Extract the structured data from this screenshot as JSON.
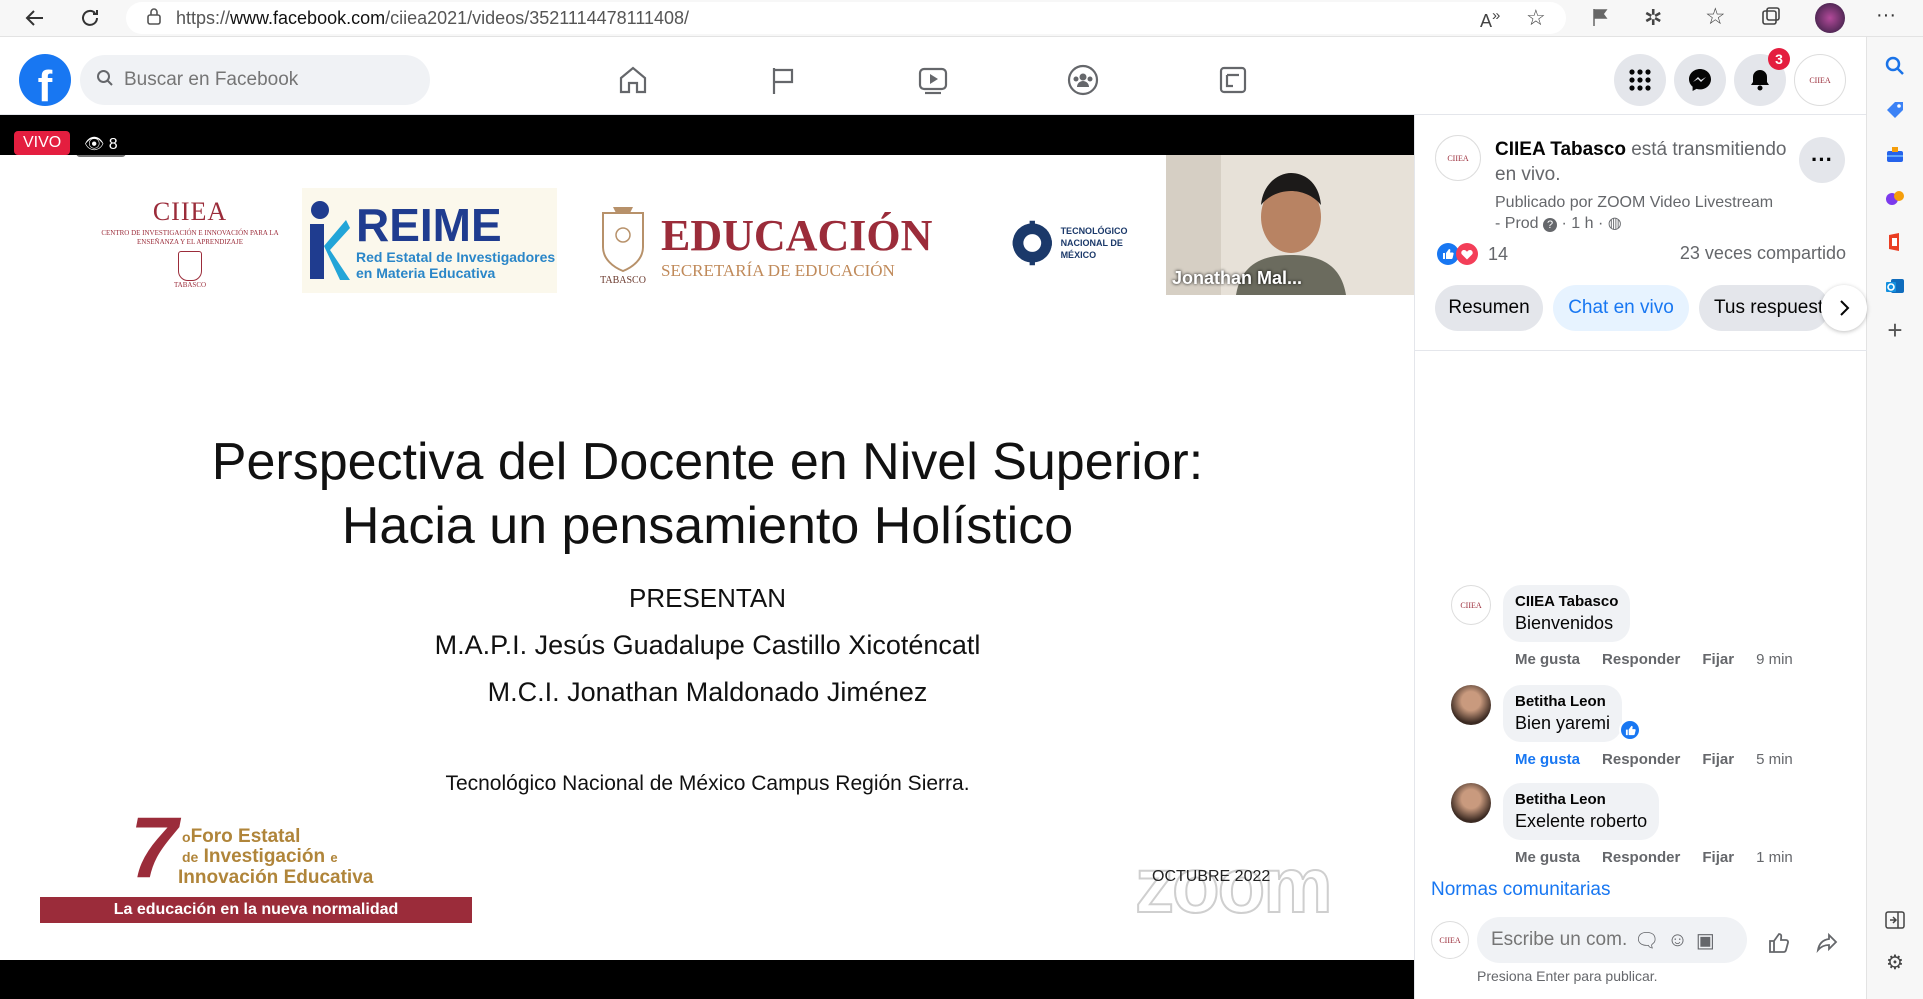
{
  "browser": {
    "url_prefix": "https://",
    "url_host": "www.facebook.com",
    "url_path": "/ciiea2021/videos/3521114478111408/"
  },
  "facebook": {
    "search_placeholder": "Buscar en Facebook",
    "notification_count": "3",
    "avatar_label": "CIIEA"
  },
  "video": {
    "live_label": "VIVO",
    "viewers": "8",
    "slide": {
      "ciiea_logo_title": "CIIEA",
      "ciiea_logo_subtitle": "CENTRO DE INVESTIGACIÓN E INNOVACIÓN PARA LA ENSEÑANZA Y EL APRENDIZAJE",
      "ciiea_logo_place": "TABASCO",
      "reime_title": "REIME",
      "reime_line1": "Red Estatal de Investigadores",
      "reime_line2": "en Materia Educativa",
      "edu_title": "EDUCACIÓN",
      "edu_subtitle": "SECRETARÍA DE EDUCACIÓN",
      "edu_place": "TABASCO",
      "tec_line1": "TECNOLÓGICO",
      "tec_line2": "NACIONAL DE MÉXICO",
      "title_line1": "Perspectiva del Docente en Nivel Superior:",
      "title_line2": "Hacia un pensamiento Holístico",
      "presentan": "PRESENTAN",
      "presenter1": "M.A.P.I. Jesús Guadalupe Castillo Xicoténcatl",
      "presenter2": "M.C.I. Jonathan Maldonado Jiménez",
      "institution": "Tecnológico Nacional de México Campus Región Sierra.",
      "foro_number": "7",
      "foro_sup": "o",
      "foro_line1": "Foro Estatal",
      "foro_line2_prefix": "de",
      "foro_line2": "Investigación",
      "foro_line2_suffix": "e",
      "foro_line3": "Innovación Educativa",
      "foro_banner": "La educación en la nueva normalidad",
      "date": "OCTUBRE 2022",
      "zoom_watermark": "zoom"
    },
    "camera_name": "Jonathan Mal..."
  },
  "panel": {
    "page_name": "CIIEA Tabasco",
    "status_line1": "está transmitiendo",
    "status_line2": "en vivo.",
    "published_by": "Publicado por ZOOM Video Livestream",
    "meta_prefix": "- Prod",
    "meta_time": "· 1 h ·",
    "reactions": "14",
    "shares": "23 veces compartido",
    "tabs": [
      "Resumen",
      "Chat en vivo",
      "Tus respuesta"
    ],
    "comments": [
      {
        "name": "CIIEA Tabasco",
        "text": "Bienvenidos",
        "like": "Me gusta",
        "reply": "Responder",
        "pin": "Fijar",
        "time": "9 min"
      },
      {
        "name": "Betitha Leon",
        "text": "Bien yaremi",
        "like": "Me gusta",
        "reply": "Responder",
        "pin": "Fijar",
        "time": "5 min"
      },
      {
        "name": "Betitha Leon",
        "text": "Exelente roberto",
        "like": "Me gusta",
        "reply": "Responder",
        "pin": "Fijar",
        "time": "1 min"
      }
    ],
    "community_link": "Normas comunitarias",
    "composer_placeholder": "Escribe un com...",
    "composer_hint": "Presiona Enter para publicar."
  }
}
